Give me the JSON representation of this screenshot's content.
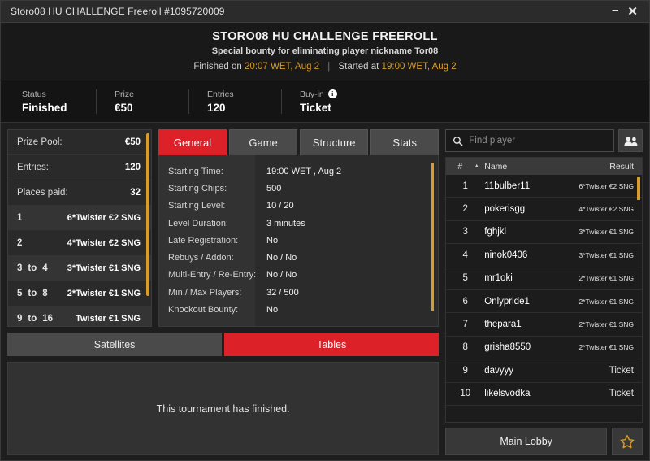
{
  "titlebar": {
    "text": "Storo08 HU CHALLENGE Freeroll #1095720009",
    "minimize": "–",
    "close": "✕"
  },
  "header": {
    "title": "STORO08 HU CHALLENGE FREEROLL",
    "subtitle": "Special bounty for eliminating player nickname Tor08",
    "finished_prefix": "Finished on",
    "finished_time": "20:07 WET",
    "finished_date": ", Aug 2",
    "separator": "|",
    "started_prefix": "Started at",
    "started_time": "19:00 WET",
    "started_date": ", Aug 2",
    "accent_color": "#d89b2a"
  },
  "status": {
    "cells": [
      {
        "label": "Status",
        "value": "Finished",
        "info": false
      },
      {
        "label": "Prize",
        "value": "€50",
        "info": false
      },
      {
        "label": "Entries",
        "value": "120",
        "info": false
      },
      {
        "label": "Buy-in",
        "value": "Ticket",
        "info": true
      }
    ]
  },
  "prize_pool": {
    "summary": [
      {
        "label": "Prize Pool:",
        "value": "€50"
      },
      {
        "label": "Entries:",
        "value": "120"
      },
      {
        "label": "Places paid:",
        "value": "32"
      }
    ],
    "payouts": [
      {
        "from": "1",
        "to": "",
        "conn": "",
        "prize": "6*Twister €2 SNG"
      },
      {
        "from": "2",
        "to": "",
        "conn": "",
        "prize": "4*Twister €2 SNG"
      },
      {
        "from": "3",
        "to": "4",
        "conn": "to",
        "prize": "3*Twister €1 SNG"
      },
      {
        "from": "5",
        "to": "8",
        "conn": "to",
        "prize": "2*Twister €1 SNG"
      },
      {
        "from": "9",
        "to": "16",
        "conn": "to",
        "prize": "Twister €1 SNG"
      }
    ]
  },
  "tabs": {
    "items": [
      "General",
      "Game",
      "Structure",
      "Stats"
    ],
    "active": "General",
    "active_color": "#dc2128"
  },
  "general": {
    "rows": [
      {
        "label": "Starting Time:",
        "value": "19:00 WET , Aug 2"
      },
      {
        "label": "Starting Chips:",
        "value": "500"
      },
      {
        "label": "Starting Level:",
        "value": "10 / 20"
      },
      {
        "label": "Level Duration:",
        "value": "3 minutes"
      },
      {
        "label": "Late Registration:",
        "value": "No"
      },
      {
        "label": "Rebuys / Addon:",
        "value": "No / No"
      },
      {
        "label": "Multi-Entry / Re-Entry:",
        "value": "No / No"
      },
      {
        "label": "Min / Max Players:",
        "value": "32 / 500"
      },
      {
        "label": "Knockout Bounty:",
        "value": "No"
      }
    ]
  },
  "sat_tabs": {
    "items": [
      "Satellites",
      "Tables"
    ],
    "active": "Tables"
  },
  "tables_panel": {
    "message": "This tournament has finished."
  },
  "search": {
    "placeholder": "Find player",
    "value": ""
  },
  "players": {
    "headers": {
      "num": "#",
      "sort_arrow": "▲",
      "name": "Name",
      "result": "Result"
    },
    "rows": [
      {
        "num": "1",
        "name": "11bulber11",
        "result": "6*Twister €2 SNG",
        "ticket": false
      },
      {
        "num": "2",
        "name": "pokerisgg",
        "result": "4*Twister €2 SNG",
        "ticket": false
      },
      {
        "num": "3",
        "name": "fghjkl",
        "result": "3*Twister €1 SNG",
        "ticket": false
      },
      {
        "num": "4",
        "name": "ninok0406",
        "result": "3*Twister €1 SNG",
        "ticket": false
      },
      {
        "num": "5",
        "name": "mr1oki",
        "result": "2*Twister €1 SNG",
        "ticket": false
      },
      {
        "num": "6",
        "name": "Onlypride1",
        "result": "2*Twister €1 SNG",
        "ticket": false
      },
      {
        "num": "7",
        "name": "thepara1",
        "result": "2*Twister €1 SNG",
        "ticket": false
      },
      {
        "num": "8",
        "name": "grisha8550",
        "result": "2*Twister €1 SNG",
        "ticket": false
      },
      {
        "num": "9",
        "name": "davyyy",
        "result": "Ticket",
        "ticket": true
      },
      {
        "num": "10",
        "name": "likelsvodka",
        "result": "Ticket",
        "ticket": true
      }
    ]
  },
  "footer": {
    "main_lobby": "Main Lobby",
    "star_color": "#d79c29"
  }
}
